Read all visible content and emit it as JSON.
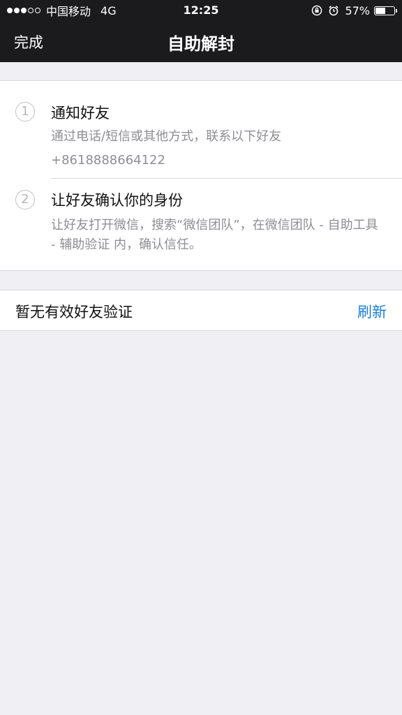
{
  "status_bar": {
    "carrier": "中国移动",
    "network": "4G",
    "time": "12:25",
    "battery_percent": "57%",
    "battery_level": 0.57,
    "signal_bars_filled": 3,
    "signal_bars_total": 5,
    "icons": [
      "orientation-lock-icon",
      "alarm-icon",
      "battery-icon"
    ]
  },
  "nav": {
    "done_label": "完成",
    "title": "自助解封"
  },
  "steps": [
    {
      "number": "1",
      "title": "通知好友",
      "description": "通过电话/短信或其他方式，联系以下好友",
      "phone": "+8618888664122"
    },
    {
      "number": "2",
      "title": "让好友确认你的身份",
      "description": "让好友打开微信，搜索“微信团队”，在微信团队 - 自助工具 - 辅助验证 内，确认信任。"
    }
  ],
  "verification": {
    "status_text": "暂无有效好友验证",
    "refresh_label": "刷新"
  },
  "colors": {
    "nav_background": "#1b1b1e",
    "page_background": "#efeff4",
    "link_blue": "#1a7ddb",
    "secondary_text": "#8e8e93"
  }
}
